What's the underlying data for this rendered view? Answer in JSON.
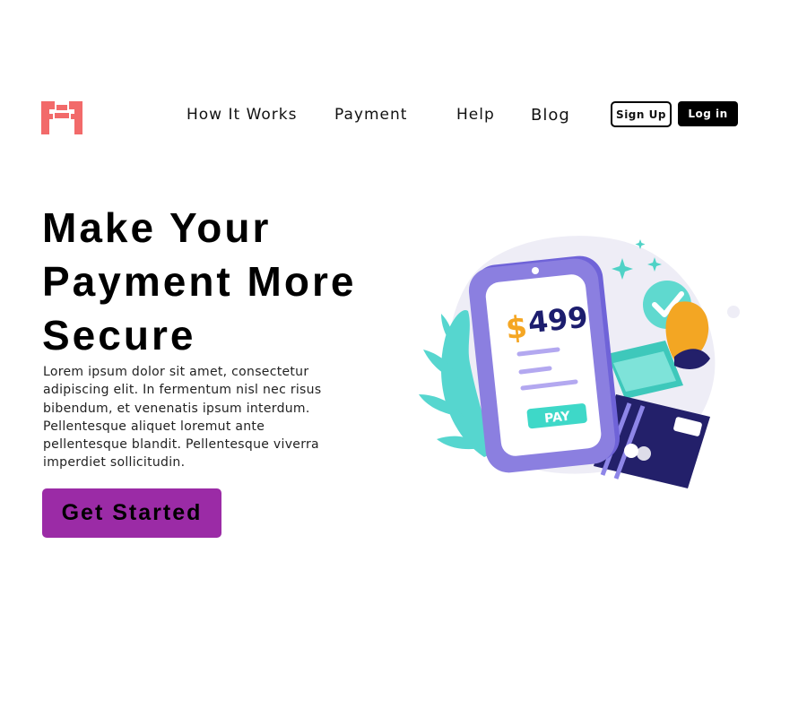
{
  "header": {
    "logo_icon": "brand-logo-icon",
    "brand_color": "#f26a6a",
    "nav": [
      {
        "label": "How It Works"
      },
      {
        "label": "Payment"
      },
      {
        "label": "Help"
      },
      {
        "label": "Blog"
      }
    ],
    "signup_label": "Sign Up",
    "login_label": "Log in"
  },
  "hero": {
    "title": "Make Your Payment More Secure",
    "description": "Lorem ipsum dolor sit amet, consectetur adipiscing elit. In fermentum nisl nec risus bibendum, et venenatis ipsum interdum. Pellentesque aliquet loremut ante pellentesque blandit. Pellentesque viverra imperdiet sollicitudin.",
    "cta_label": "Get Started",
    "cta_color": "#9b2ba6"
  },
  "illustration": {
    "amount_symbol": "$",
    "amount": "499",
    "pay_label": "PAY",
    "colors": {
      "phone": "#8b7fe0",
      "screen": "#ffffff",
      "amount_symbol": "#f5a623",
      "amount": "#1c1d6e",
      "pay_button": "#3ed8c8",
      "card": "#23206a",
      "leaf": "#56d6cf",
      "check_badge": "#5fd9cf",
      "glove": "#f3a623"
    }
  }
}
